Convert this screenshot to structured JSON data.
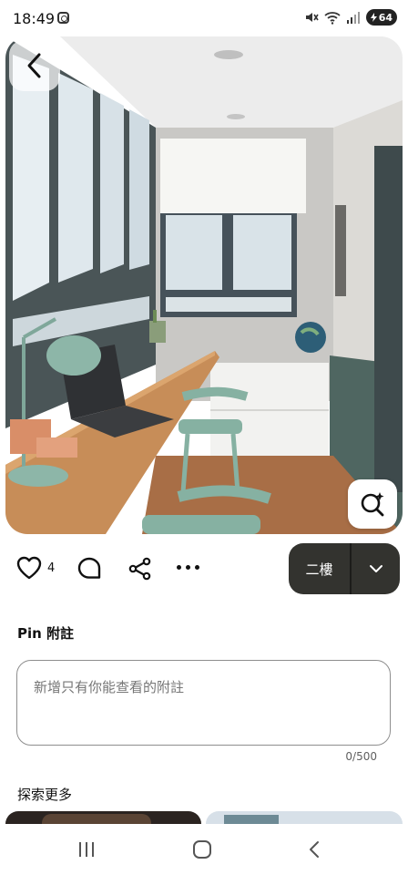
{
  "status_bar": {
    "time": "18:49",
    "battery": "64",
    "icons": [
      "instagram-icon",
      "mute-icon",
      "wifi-icon",
      "signal-icon",
      "battery-charging-icon"
    ]
  },
  "pin": {
    "image_subject": "sunroom home office with long wooden desk, laptop, sage green lamp and chairs, gray window frames",
    "back_icon": "chevron-left-icon",
    "lens_icon": "visual-search-icon"
  },
  "actions": {
    "like_count": "4",
    "like_icon": "heart-icon",
    "comment_icon": "comment-icon",
    "share_icon": "share-icon",
    "more_icon": "more-dots-icon",
    "board_name": "二樓",
    "dropdown_icon": "chevron-down-icon"
  },
  "notes": {
    "title": "Pin 附註",
    "placeholder": "新增只有你能查看的附註",
    "value": "",
    "counter": "0/500"
  },
  "explore": {
    "title": "探索更多"
  },
  "colors": {
    "board_button_bg": "#33332f",
    "text": "#111111",
    "field_border": "#8e8e8e"
  }
}
